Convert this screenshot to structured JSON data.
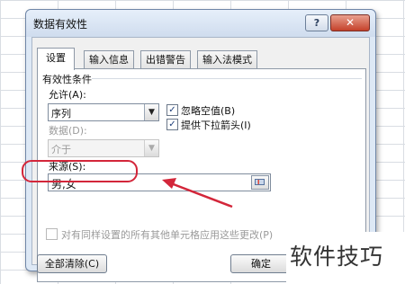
{
  "dialog": {
    "title": "数据有效性",
    "help_glyph": "?",
    "close_glyph": "✕"
  },
  "tabs": [
    {
      "label": "设置",
      "active": true
    },
    {
      "label": "输入信息",
      "active": false
    },
    {
      "label": "出错警告",
      "active": false
    },
    {
      "label": "输入法模式",
      "active": false
    }
  ],
  "settings": {
    "group_title": "有效性条件",
    "allow_label": "允许(A):",
    "allow_value": "序列",
    "data_label": "数据(D):",
    "data_value": "介于",
    "ignore_blank_label": "忽略空值(B)",
    "ignore_blank_checked": true,
    "dropdown_label": "提供下拉箭头(I)",
    "dropdown_checked": true,
    "source_label": "来源(S):",
    "source_value": "男,女",
    "apply_all_label": "对有同样设置的所有其他单元格应用这些更改(P)",
    "apply_all_checked": false
  },
  "buttons": {
    "clear_all": "全部清除(C)",
    "ok": "确定"
  },
  "watermark": "软件技巧",
  "colors": {
    "annotation_red": "#d3263a",
    "dialog_frame": "#dde8f5"
  }
}
